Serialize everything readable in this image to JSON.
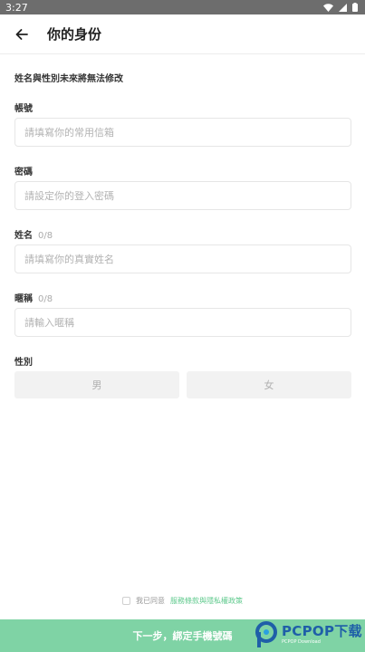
{
  "status": {
    "time": "3:27"
  },
  "header": {
    "title": "你的身份"
  },
  "notice": "姓名與性別未來將無法修改",
  "fields": {
    "account": {
      "label": "帳號",
      "placeholder": "請填寫你的常用信箱"
    },
    "password": {
      "label": "密碼",
      "placeholder": "請設定你的登入密碼"
    },
    "name": {
      "label": "姓名",
      "count": "0/8",
      "placeholder": "請填寫你的真實姓名"
    },
    "nickname": {
      "label": "暱稱",
      "count": "0/8",
      "placeholder": "請輸入暱稱"
    }
  },
  "gender": {
    "label": "性別",
    "male": "男",
    "female": "女"
  },
  "agreement": {
    "prefix": "我已同意",
    "link": "服務條款與隱私權政策"
  },
  "next_button": "下一步，綁定手機號碼",
  "watermark": {
    "brand": "PCPOP下载",
    "sub": "PCPOP Download"
  },
  "colors": {
    "accent": "#7fd3a5",
    "link": "#5ec98c",
    "statusbar": "#6d6d6d"
  }
}
